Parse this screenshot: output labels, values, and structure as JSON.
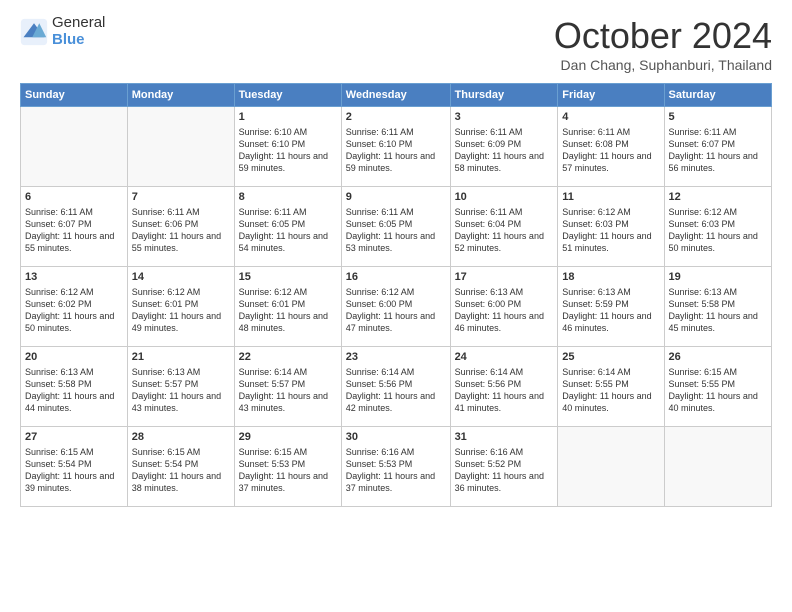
{
  "header": {
    "logo_general": "General",
    "logo_blue": "Blue",
    "month": "October 2024",
    "location": "Dan Chang, Suphanburi, Thailand"
  },
  "days_of_week": [
    "Sunday",
    "Monday",
    "Tuesday",
    "Wednesday",
    "Thursday",
    "Friday",
    "Saturday"
  ],
  "weeks": [
    [
      {
        "day": "",
        "content": ""
      },
      {
        "day": "",
        "content": ""
      },
      {
        "day": "1",
        "content": "Sunrise: 6:10 AM\nSunset: 6:10 PM\nDaylight: 11 hours and 59 minutes."
      },
      {
        "day": "2",
        "content": "Sunrise: 6:11 AM\nSunset: 6:10 PM\nDaylight: 11 hours and 59 minutes."
      },
      {
        "day": "3",
        "content": "Sunrise: 6:11 AM\nSunset: 6:09 PM\nDaylight: 11 hours and 58 minutes."
      },
      {
        "day": "4",
        "content": "Sunrise: 6:11 AM\nSunset: 6:08 PM\nDaylight: 11 hours and 57 minutes."
      },
      {
        "day": "5",
        "content": "Sunrise: 6:11 AM\nSunset: 6:07 PM\nDaylight: 11 hours and 56 minutes."
      }
    ],
    [
      {
        "day": "6",
        "content": "Sunrise: 6:11 AM\nSunset: 6:07 PM\nDaylight: 11 hours and 55 minutes."
      },
      {
        "day": "7",
        "content": "Sunrise: 6:11 AM\nSunset: 6:06 PM\nDaylight: 11 hours and 55 minutes."
      },
      {
        "day": "8",
        "content": "Sunrise: 6:11 AM\nSunset: 6:05 PM\nDaylight: 11 hours and 54 minutes."
      },
      {
        "day": "9",
        "content": "Sunrise: 6:11 AM\nSunset: 6:05 PM\nDaylight: 11 hours and 53 minutes."
      },
      {
        "day": "10",
        "content": "Sunrise: 6:11 AM\nSunset: 6:04 PM\nDaylight: 11 hours and 52 minutes."
      },
      {
        "day": "11",
        "content": "Sunrise: 6:12 AM\nSunset: 6:03 PM\nDaylight: 11 hours and 51 minutes."
      },
      {
        "day": "12",
        "content": "Sunrise: 6:12 AM\nSunset: 6:03 PM\nDaylight: 11 hours and 50 minutes."
      }
    ],
    [
      {
        "day": "13",
        "content": "Sunrise: 6:12 AM\nSunset: 6:02 PM\nDaylight: 11 hours and 50 minutes."
      },
      {
        "day": "14",
        "content": "Sunrise: 6:12 AM\nSunset: 6:01 PM\nDaylight: 11 hours and 49 minutes."
      },
      {
        "day": "15",
        "content": "Sunrise: 6:12 AM\nSunset: 6:01 PM\nDaylight: 11 hours and 48 minutes."
      },
      {
        "day": "16",
        "content": "Sunrise: 6:12 AM\nSunset: 6:00 PM\nDaylight: 11 hours and 47 minutes."
      },
      {
        "day": "17",
        "content": "Sunrise: 6:13 AM\nSunset: 6:00 PM\nDaylight: 11 hours and 46 minutes."
      },
      {
        "day": "18",
        "content": "Sunrise: 6:13 AM\nSunset: 5:59 PM\nDaylight: 11 hours and 46 minutes."
      },
      {
        "day": "19",
        "content": "Sunrise: 6:13 AM\nSunset: 5:58 PM\nDaylight: 11 hours and 45 minutes."
      }
    ],
    [
      {
        "day": "20",
        "content": "Sunrise: 6:13 AM\nSunset: 5:58 PM\nDaylight: 11 hours and 44 minutes."
      },
      {
        "day": "21",
        "content": "Sunrise: 6:13 AM\nSunset: 5:57 PM\nDaylight: 11 hours and 43 minutes."
      },
      {
        "day": "22",
        "content": "Sunrise: 6:14 AM\nSunset: 5:57 PM\nDaylight: 11 hours and 43 minutes."
      },
      {
        "day": "23",
        "content": "Sunrise: 6:14 AM\nSunset: 5:56 PM\nDaylight: 11 hours and 42 minutes."
      },
      {
        "day": "24",
        "content": "Sunrise: 6:14 AM\nSunset: 5:56 PM\nDaylight: 11 hours and 41 minutes."
      },
      {
        "day": "25",
        "content": "Sunrise: 6:14 AM\nSunset: 5:55 PM\nDaylight: 11 hours and 40 minutes."
      },
      {
        "day": "26",
        "content": "Sunrise: 6:15 AM\nSunset: 5:55 PM\nDaylight: 11 hours and 40 minutes."
      }
    ],
    [
      {
        "day": "27",
        "content": "Sunrise: 6:15 AM\nSunset: 5:54 PM\nDaylight: 11 hours and 39 minutes."
      },
      {
        "day": "28",
        "content": "Sunrise: 6:15 AM\nSunset: 5:54 PM\nDaylight: 11 hours and 38 minutes."
      },
      {
        "day": "29",
        "content": "Sunrise: 6:15 AM\nSunset: 5:53 PM\nDaylight: 11 hours and 37 minutes."
      },
      {
        "day": "30",
        "content": "Sunrise: 6:16 AM\nSunset: 5:53 PM\nDaylight: 11 hours and 37 minutes."
      },
      {
        "day": "31",
        "content": "Sunrise: 6:16 AM\nSunset: 5:52 PM\nDaylight: 11 hours and 36 minutes."
      },
      {
        "day": "",
        "content": ""
      },
      {
        "day": "",
        "content": ""
      }
    ]
  ]
}
